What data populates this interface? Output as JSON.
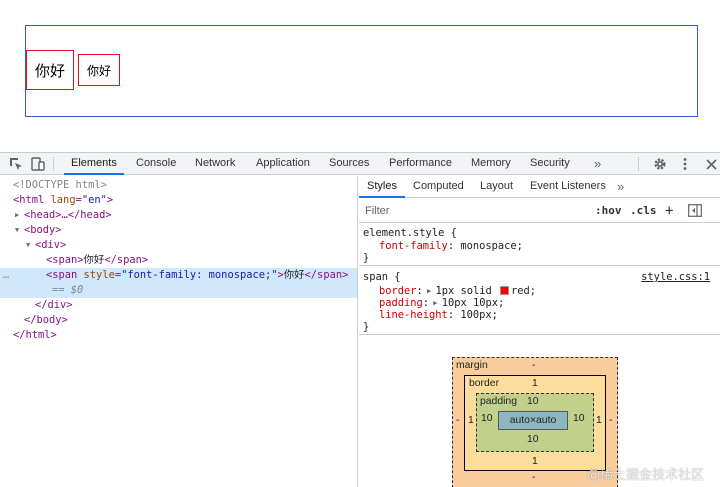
{
  "viewport": {
    "span1_text": "你好",
    "span2_text": "你好",
    "colors": {
      "div_border": "#3a5bd9",
      "span_border": "#e0121f"
    }
  },
  "devtools": {
    "main_tabs": [
      "Elements",
      "Console",
      "Network",
      "Application",
      "Sources",
      "Performance",
      "Memory",
      "Security"
    ],
    "active_main_tab": "Elements",
    "more_tabs_glyph": "»",
    "tool_icons": [
      "inspect-icon",
      "device-toggle-icon",
      "gear-icon",
      "kebab-menu-icon",
      "close-icon"
    ],
    "dom": {
      "doctype": "<!DOCTYPE html>",
      "html_open_tag": "<html",
      "html_lang_attr": "lang",
      "html_lang_val": "\"en\"",
      "html_close_bracket": ">",
      "head_line": "<head>…</head>",
      "body_open": "<body>",
      "div_open": "<div>",
      "span1_open": "<span>",
      "span1_text": "你好",
      "span1_close": "</span>",
      "span2_open": "<span",
      "span2_attr": "style",
      "span2_attr_val": "\"font-family: monospace;\"",
      "span2_close_bracket": ">",
      "span2_text": "你好",
      "span2_close": "</span>",
      "eq_dollar": "== $0",
      "div_close": "</div>",
      "body_close": "</body>",
      "html_close": "</html>",
      "ellipsis": "…"
    },
    "styles": {
      "sub_tabs": [
        "Styles",
        "Computed",
        "Layout",
        "Event Listeners"
      ],
      "active_sub_tab": "Styles",
      "more_glyph": "»",
      "filter_placeholder": "Filter",
      "hov_label": ":hov",
      "cls_label": ".cls",
      "plus_label": "+",
      "rules": {
        "element_style": {
          "selector": "element.style {",
          "prop": "font-family",
          "value": "monospace;",
          "close": "}"
        },
        "span_rule": {
          "selector": "span {",
          "source": "style.css:1",
          "props": [
            {
              "name": "border",
              "value": "1px solid ",
              "value_after": "red;"
            },
            {
              "name": "padding",
              "value": "10px 10px;"
            },
            {
              "name": "line-height",
              "value": "100px;"
            }
          ],
          "close": "}"
        }
      },
      "swatch_color": "#ff0000",
      "box_model": {
        "margin_label": "margin",
        "margin_top": "-",
        "margin_left": "-",
        "margin_right": "-",
        "margin_bottom": "-",
        "border_label": "border",
        "border_top": "1",
        "border_left": "1",
        "border_right": "1",
        "border_bottom": "1",
        "padding_label": "padding",
        "padding_top": "10",
        "padding_left": "10",
        "padding_right": "10",
        "padding_bottom": "10",
        "content": "auto×auto",
        "colors": {
          "margin": "#f9cc9d",
          "border": "#fddd9b",
          "padding": "#c3d08b",
          "content": "#8cb6c0"
        }
      }
    }
  },
  "watermark": "@稀土掘金技术社区"
}
